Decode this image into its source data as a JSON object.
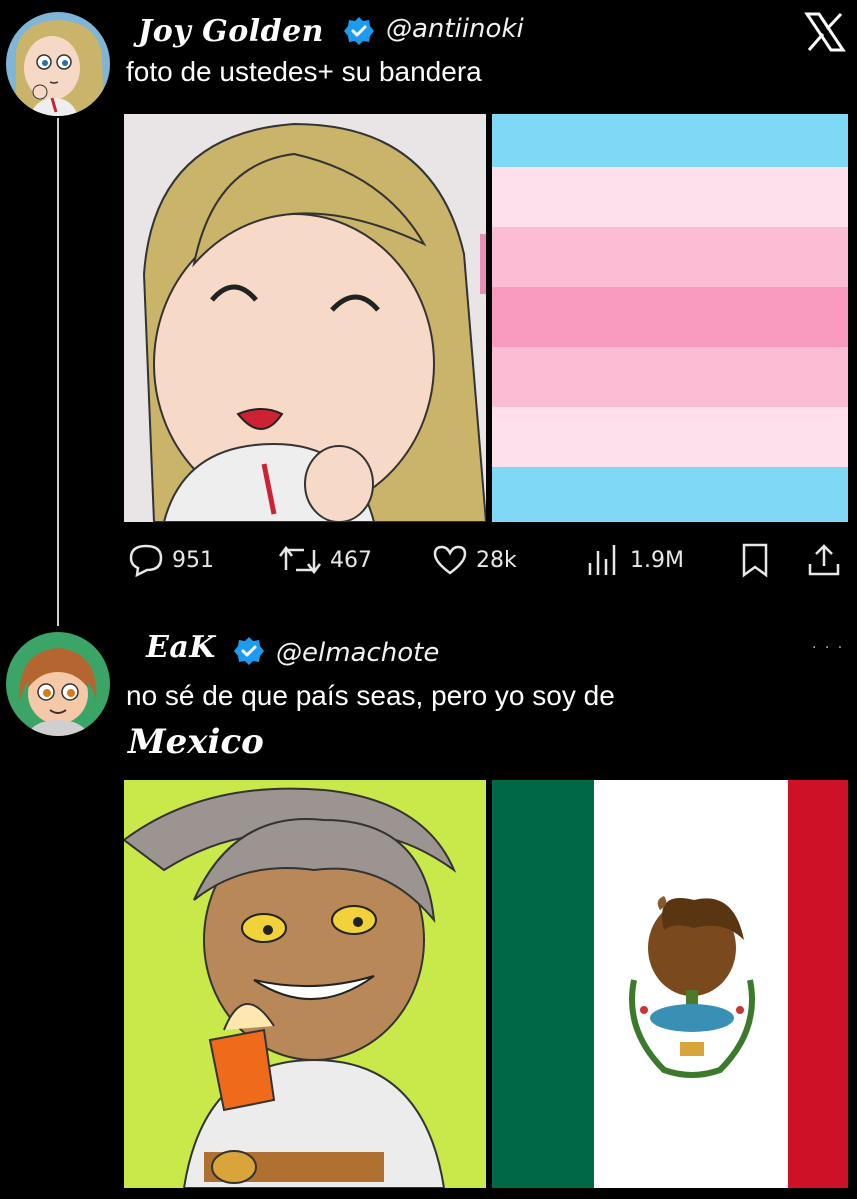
{
  "tweet1": {
    "display_name": "Joy Golden",
    "handle": "@antiinoki",
    "text": "foto de ustedes+ su bandera",
    "stats": {
      "replies": "951",
      "retweets": "467",
      "likes": "28k",
      "views": "1.9M"
    },
    "flag_colors": [
      "#7fd8f5",
      "#fde0ec",
      "#fbbcd4",
      "#f99bbf",
      "#fbbcd4",
      "#fde0ec",
      "#7fd8f5"
    ]
  },
  "tweet2": {
    "display_name": "EaK",
    "handle": "@elmachote",
    "text_line1": "no sé de que país seas, pero yo soy de",
    "text_line2": "Mexico",
    "flag_colors": [
      "#006847",
      "#ffffff",
      "#ce1126"
    ]
  },
  "icons": {
    "logo": "x-logo-icon",
    "verified": "verified-badge-icon",
    "reply": "reply-icon",
    "retweet": "retweet-icon",
    "like": "heart-icon",
    "views": "views-icon",
    "bookmark": "bookmark-icon",
    "share": "share-icon"
  },
  "colors": {
    "background": "#000000",
    "verified_blue": "#1d9bf0"
  }
}
